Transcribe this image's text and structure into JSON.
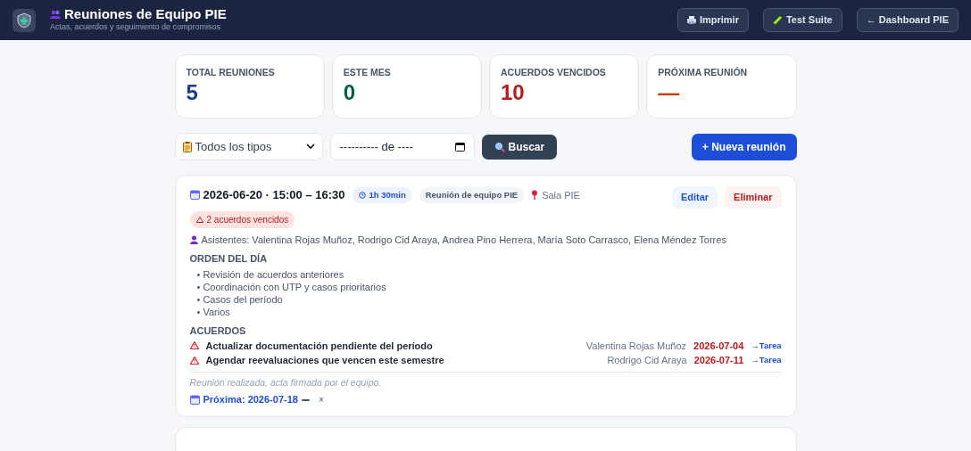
{
  "header": {
    "title": "Reuniones de Equipo PIE",
    "subtitle": "Actas, acuerdos y seguimiento de compromisos",
    "buttons": [
      {
        "label": "Imprimir"
      },
      {
        "label": "Test Suite"
      },
      {
        "label": "← Dashboard PIE"
      }
    ]
  },
  "stats": [
    {
      "label": "TOTAL REUNIONES",
      "value": "5",
      "color": "#1e3a8a"
    },
    {
      "label": "ESTE MES",
      "value": "0",
      "color": "#065f46"
    },
    {
      "label": "ACUERDOS VENCIDOS",
      "value": "10",
      "color": "#b91c1c"
    },
    {
      "label": "PRÓXIMA REUNIÓN",
      "value": "—",
      "color": "#c2410c"
    }
  ],
  "filters": {
    "type_select": "Todos los tipos",
    "date_field": {
      "placeholder": "---------- de ----"
    },
    "search_button": "Buscar",
    "new_button": "+ Nueva reunión"
  },
  "meetings": [
    {
      "datetime": "2026-06-20 · 15:00 – 16:30",
      "duration": "1h 30min",
      "type": "Reunión de equipo PIE",
      "location": "Sala PIE",
      "edit": "Editar",
      "delete": "Eliminar",
      "overdue_badge": "2 acuerdos vencidos",
      "attendees": "Asistentes: Valentina Rojas Muñoz, Rodrigo Cid Araya, Andrea Pino Herrera, María Soto Carrasco, Elena Méndez Torres",
      "agenda_title": "ORDEN DEL DÍA",
      "agenda": [
        "• Revisión de acuerdos anteriores",
        "• Coordinación con UTP y casos prioritarios",
        "• Casos del período",
        "• Varios"
      ],
      "agreements_title": "ACUERDOS",
      "agreements": [
        {
          "text": "Actualizar documentación pendiente del período",
          "overdue": true,
          "owner": "Valentina Rojas Muñoz",
          "due": "2026-07-04",
          "link": "→Tarea"
        },
        {
          "text": "Agendar reevaluaciones que vencen este semestre",
          "overdue": true,
          "owner": "Rodrigo Cid Araya",
          "due": "2026-07-11",
          "link": "→Tarea"
        }
      ],
      "note": "Reunión realizada, acta firmada por el equipo.",
      "next": "Próxima: 2026-07-18",
      "close": "×"
    }
  ]
}
